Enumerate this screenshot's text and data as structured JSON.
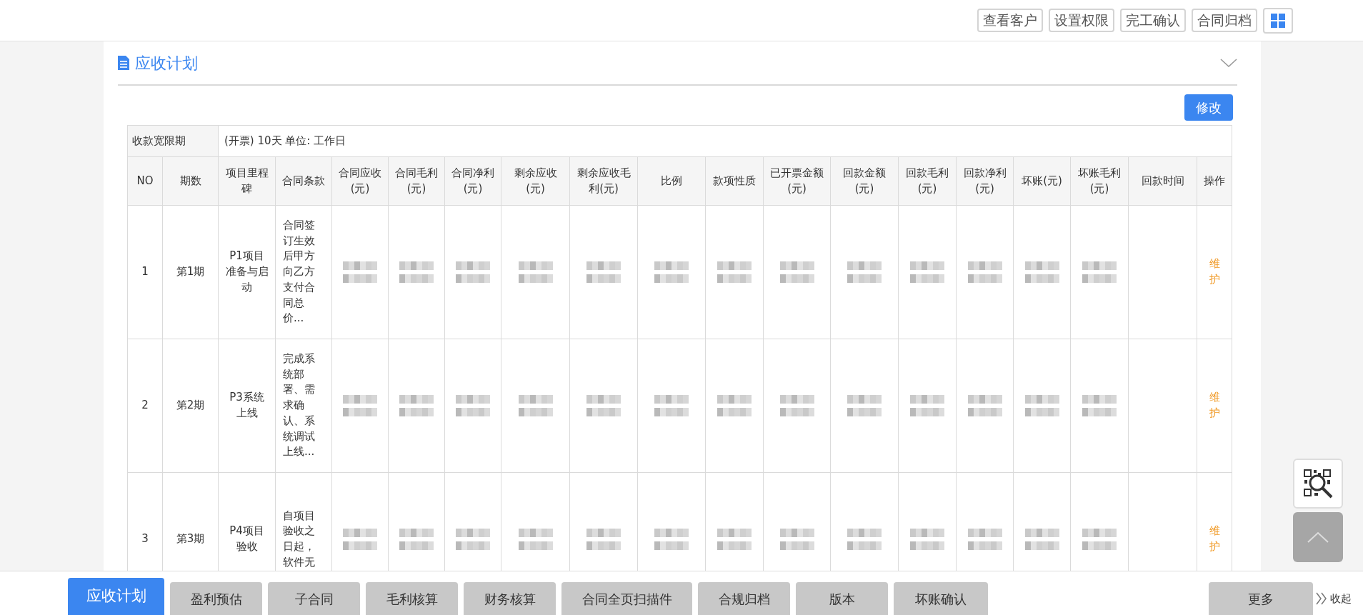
{
  "toolbar": {
    "buttons": [
      "查看客户",
      "设置权限",
      "完工确认",
      "合同归档"
    ]
  },
  "section": {
    "title": "应收计划",
    "expanded": true,
    "edit_button": "修改"
  },
  "grace": {
    "label": "收款宽限期",
    "value": "(开票) 10天 单位: 工作日"
  },
  "columns": [
    {
      "label": "NO",
      "blurred": false
    },
    {
      "label": "期数",
      "blurred": false
    },
    {
      "label": "项目里程碑",
      "blurred": false
    },
    {
      "label": "合同条款",
      "blurred": false
    },
    {
      "label": "合同应收 (元)",
      "blurred": true
    },
    {
      "label": "合同毛利(元)",
      "blurred": true
    },
    {
      "label": "合同净利(元)",
      "blurred": true
    },
    {
      "label": "剩余应收(元)",
      "blurred": true
    },
    {
      "label": "剩余应收毛利(元)",
      "blurred": true
    },
    {
      "label": "比例",
      "blurred": true
    },
    {
      "label": "款项性质",
      "blurred": true
    },
    {
      "label": "已开票金额 (元)",
      "blurred": true
    },
    {
      "label": "回款金额(元)",
      "blurred": true
    },
    {
      "label": "回款毛利 (元)",
      "blurred": true
    },
    {
      "label": "回款净利 (元)",
      "blurred": true
    },
    {
      "label": "坏账(元)",
      "blurred": true
    },
    {
      "label": "坏账毛利(元)",
      "blurred": true
    },
    {
      "label": "回款时间",
      "blurred": false
    },
    {
      "label": "操作",
      "blurred": false
    }
  ],
  "rows": [
    {
      "no": "1",
      "period": "第1期",
      "milestone": "P1项目准备与启动",
      "terms": "合同签订生效后甲方向乙方支付合同总价...",
      "action": "维护"
    },
    {
      "no": "2",
      "period": "第2期",
      "milestone": "P3系统上线",
      "terms": "完成系统部署、需求确认、系统调试上线...",
      "action": "维护"
    },
    {
      "no": "3",
      "period": "第3期",
      "milestone": "P4项目验收",
      "terms": "自项目验收之日起，软件无",
      "action": "维护"
    }
  ],
  "tabs": [
    {
      "label": "应收计划",
      "selected": true
    },
    {
      "label": "盈利预估",
      "selected": false
    },
    {
      "label": "子合同",
      "selected": false
    },
    {
      "label": "毛利核算",
      "selected": false
    },
    {
      "label": "财务核算",
      "selected": false
    },
    {
      "label": "合同全页扫描件",
      "selected": false
    },
    {
      "label": "合规归档",
      "selected": false
    },
    {
      "label": "版本",
      "selected": false
    },
    {
      "label": "坏账确认",
      "selected": false
    }
  ],
  "more_button": "更多",
  "collapse_button": "收起"
}
